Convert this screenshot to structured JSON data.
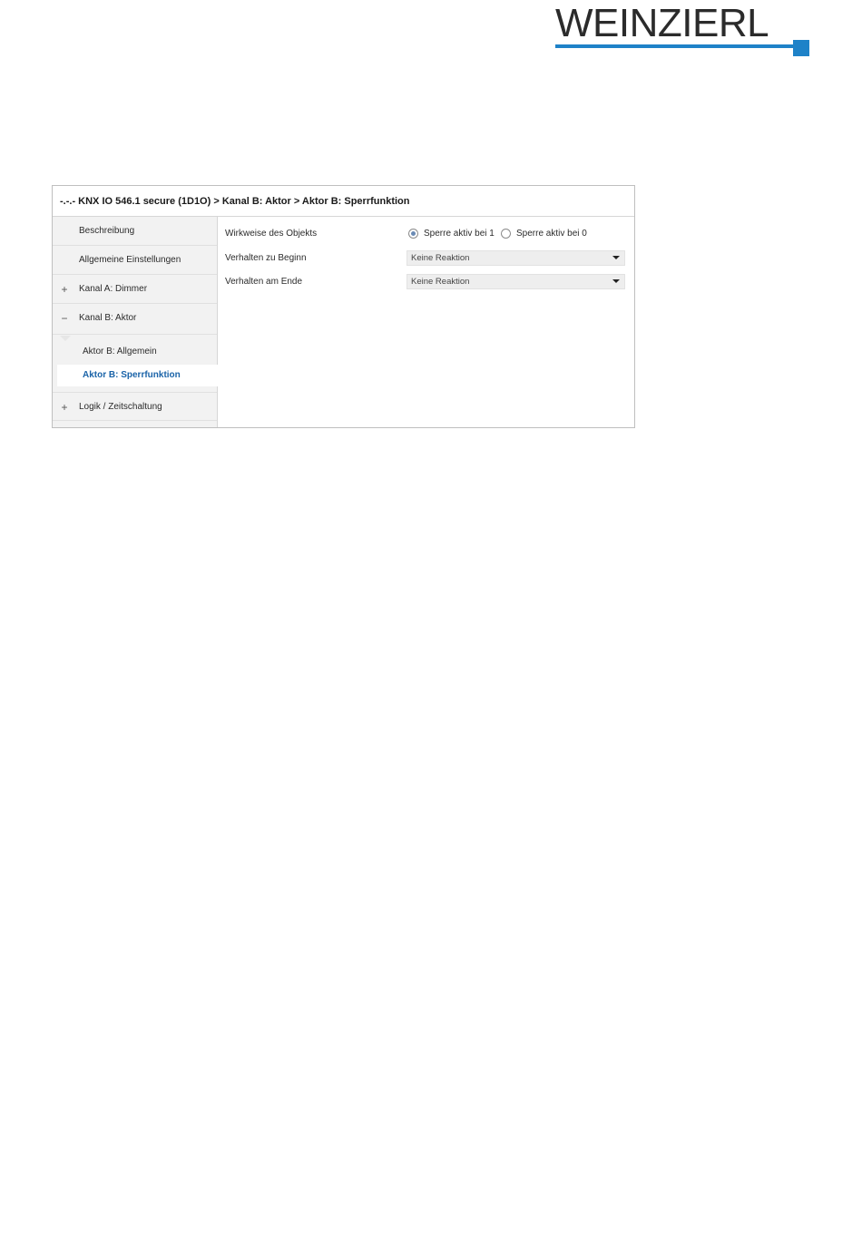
{
  "logo": {
    "text": "WEINZIERL",
    "color": "#1e82c8"
  },
  "breadcrumb": "-.-.- KNX IO 546.1 secure (1D1O) > Kanal B: Aktor > Aktor B: Sperrfunktion",
  "sidebar": {
    "items": [
      {
        "label": "Beschreibung",
        "expander": ""
      },
      {
        "label": "Allgemeine Einstellungen",
        "expander": ""
      },
      {
        "label": "Kanal A: Dimmer",
        "expander": "+"
      },
      {
        "label": "Kanal B: Aktor",
        "expander": "−"
      }
    ],
    "subitems": [
      {
        "label": "Aktor B: Allgemein",
        "active": false
      },
      {
        "label": "Aktor B: Sperrfunktion",
        "active": true
      }
    ],
    "last_item": {
      "label": "Logik / Zeitschaltung",
      "expander": "+"
    },
    "active_color": "#1a63a8"
  },
  "params": {
    "wirkweise": {
      "label": "Wirkweise des Objekts",
      "option1": "Sperre aktiv bei 1",
      "option2": "Sperre aktiv bei 0",
      "selected": "option1"
    },
    "beginn": {
      "label": "Verhalten zu Beginn",
      "value": "Keine Reaktion"
    },
    "ende": {
      "label": "Verhalten am Ende",
      "value": "Keine Reaktion"
    }
  }
}
